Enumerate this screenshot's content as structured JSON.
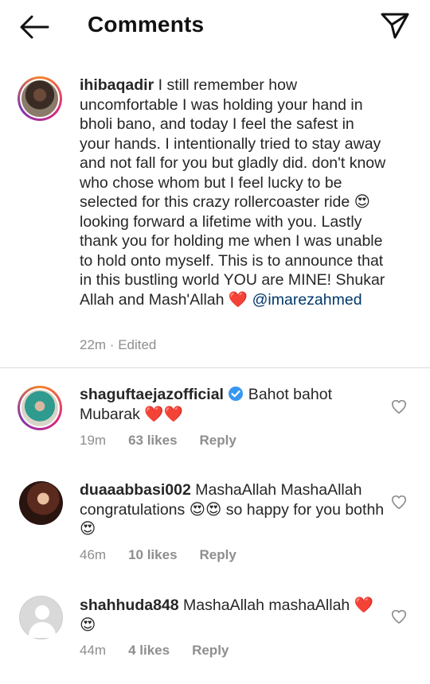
{
  "header": {
    "title": "Comments"
  },
  "caption": {
    "username": "ihibaqadir",
    "text_before": " I still remember how uncomfortable I was holding your hand in bholi bano, and today I feel the safest in your hands. I intentionally tried to stay away and not fall for you but gladly did. don't know who chose whom but I feel lucky to be selected for this crazy rollercoaster ride 😍 looking forward a lifetime with you. Lastly thank you for holding me when I was unable to hold onto myself. This is to announce that in this bustling world YOU are MINE! Shukar Allah and Mash'Allah ❤️ ",
    "mention": "@imarezahmed",
    "time": "22m",
    "edited": "Edited"
  },
  "comments": [
    {
      "username": "shaguftaejazofficial",
      "verified": true,
      "text": " Bahot bahot Mubarak ❤️❤️",
      "time": "19m",
      "likes": "63 likes",
      "reply": "Reply"
    },
    {
      "username": "duaaabbasi002",
      "text": " MashaAllah MashaAllah congratulations 😍😍 so happy for you bothh 😍",
      "time": "46m",
      "likes": "10 likes",
      "reply": "Reply"
    },
    {
      "username": "shahhuda848",
      "text": " MashaAllah mashaAllah ❤️😍",
      "time": "44m",
      "likes": "4 likes",
      "reply": "Reply"
    }
  ],
  "icons": {
    "back": "back-arrow-icon",
    "send": "direct-send-icon",
    "like": "heart-outline-icon",
    "verified": "verified-badge-icon"
  },
  "colors": {
    "verified": "#3897f0",
    "mention": "#00376b",
    "meta": "#8e8e8e"
  }
}
